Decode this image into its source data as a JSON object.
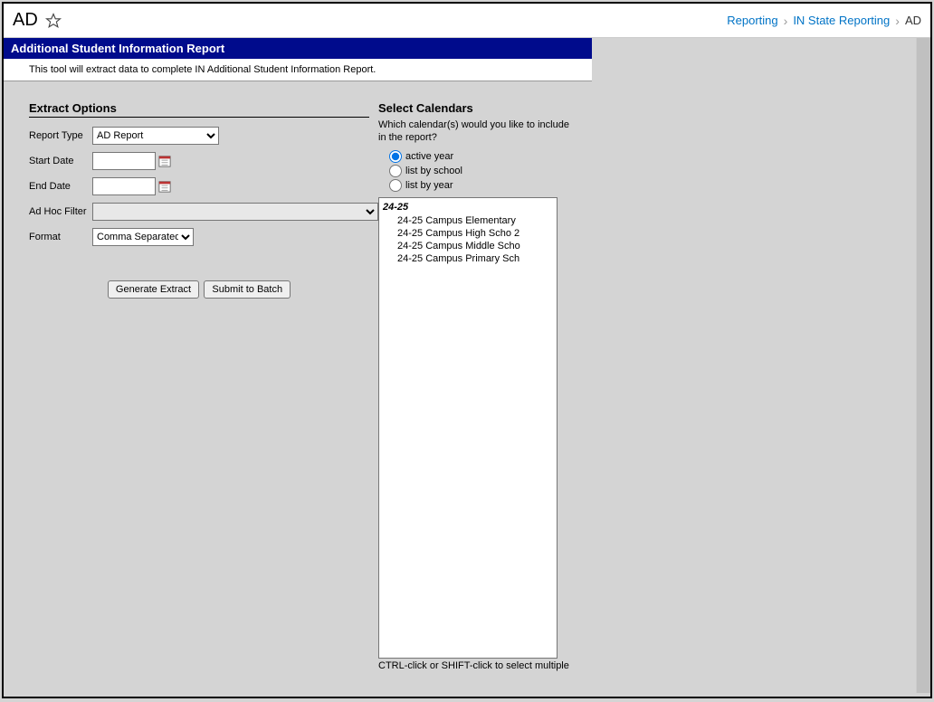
{
  "header": {
    "title": "AD",
    "breadcrumbs": {
      "reporting": "Reporting",
      "state": "IN State Reporting",
      "current": "AD"
    }
  },
  "banner": "Additional Student Information Report",
  "description": "This tool will extract data to complete IN Additional Student Information Report.",
  "extract": {
    "heading": "Extract Options",
    "reportTypeLabel": "Report Type",
    "reportTypeValue": "AD Report",
    "startDateLabel": "Start Date",
    "startDateValue": "",
    "endDateLabel": "End Date",
    "endDateValue": "",
    "adhocLabel": "Ad Hoc Filter",
    "adhocValue": "",
    "formatLabel": "Format",
    "formatValue": "Comma Separated",
    "generateBtn": "Generate Extract",
    "submitBtn": "Submit to Batch"
  },
  "calendars": {
    "heading": "Select Calendars",
    "desc": "Which calendar(s) would you like to include in the report?",
    "optActive": "active year",
    "optSchool": "list by school",
    "optYear": "list by year",
    "yearGroup": "24-25",
    "items": [
      "24-25 Campus Elementary",
      "24-25 Campus High Scho 2",
      "24-25 Campus Middle Scho",
      "24-25 Campus Primary Sch"
    ],
    "hint": "CTRL-click or SHIFT-click to select multiple"
  }
}
